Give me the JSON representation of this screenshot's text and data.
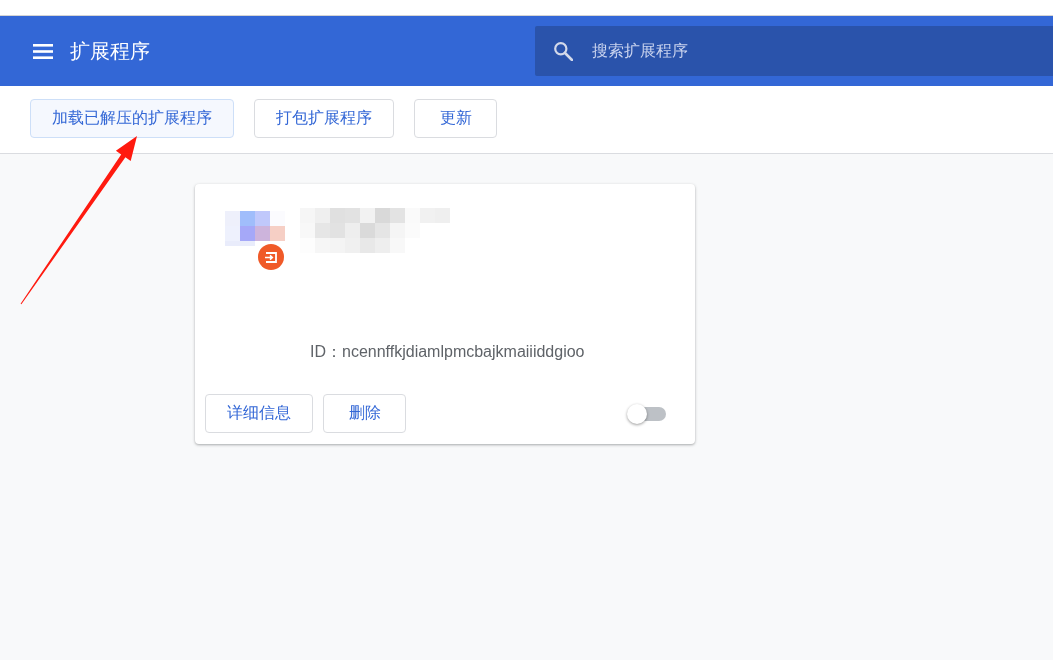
{
  "header": {
    "title": "扩展程序",
    "search": {
      "placeholder": "搜索扩展程序"
    }
  },
  "toolbar": {
    "buttons": [
      {
        "label": "加载已解压的扩展程序",
        "highlighted": true
      },
      {
        "label": "打包扩展程序",
        "highlighted": false
      },
      {
        "label": "更新",
        "highlighted": false
      }
    ]
  },
  "extension_card": {
    "id_text": "ID：ncennffkjdiamlpmcbajkmaiiiddgioo",
    "buttons": [
      {
        "label": "详细信息"
      },
      {
        "label": "删除"
      }
    ],
    "toggle": {
      "on": false
    }
  }
}
